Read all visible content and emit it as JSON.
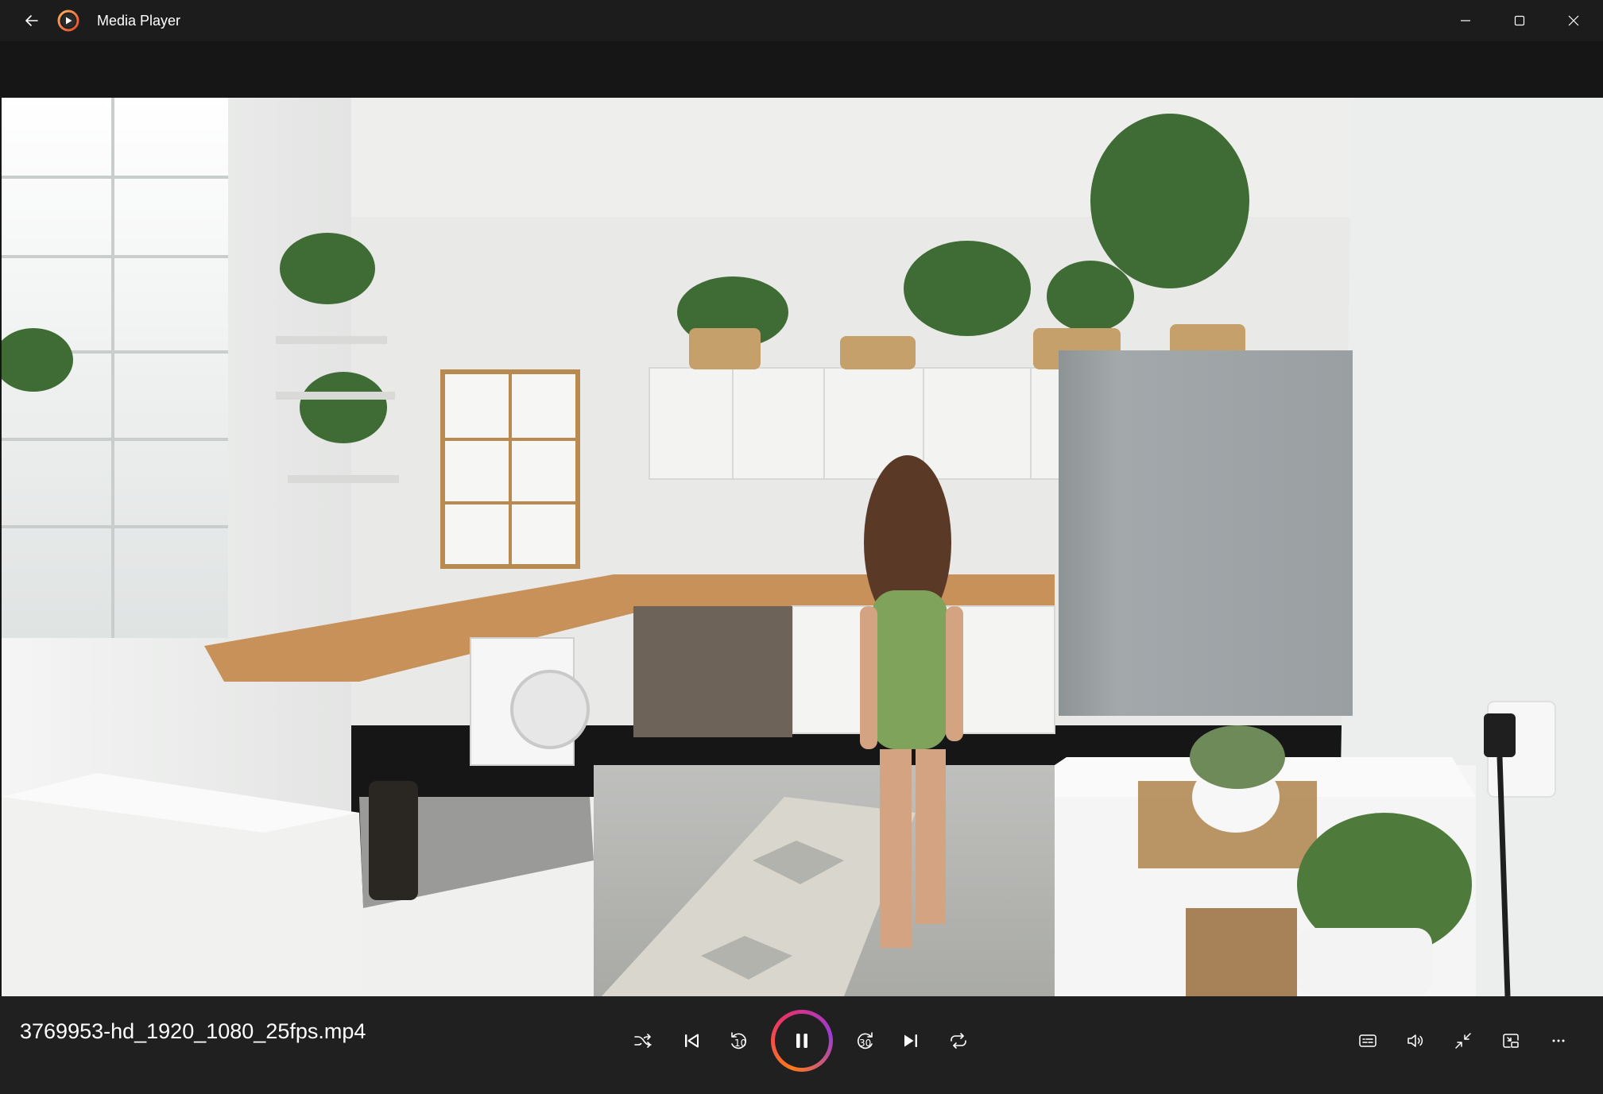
{
  "window": {
    "title": "Media Player"
  },
  "player": {
    "filename": "3769953-hd_1920_1080_25fps.mp4",
    "state": "playing",
    "skip_back_seconds": "10",
    "skip_forward_seconds": "30"
  },
  "icons": {
    "back": "back-arrow-icon",
    "app": "media-player-logo",
    "minimize": "minimize-icon",
    "maximize": "maximize-icon",
    "close": "close-icon",
    "shuffle": "shuffle-icon",
    "previous": "previous-track-icon",
    "skip_back": "skip-back-icon",
    "pause": "pause-icon",
    "skip_forward": "skip-forward-icon",
    "next": "next-track-icon",
    "repeat": "repeat-icon",
    "subtitles": "subtitles-icon",
    "volume": "volume-icon",
    "exit_fullscreen": "exit-fullscreen-icon",
    "mini_player": "mini-player-icon",
    "more": "more-options-icon"
  },
  "colors": {
    "background": "#202020",
    "titlebar": "#1c1c1c",
    "accent_ring_start": "#ff7a18",
    "accent_ring_end": "#9b3bd6",
    "text": "#ffffff"
  }
}
